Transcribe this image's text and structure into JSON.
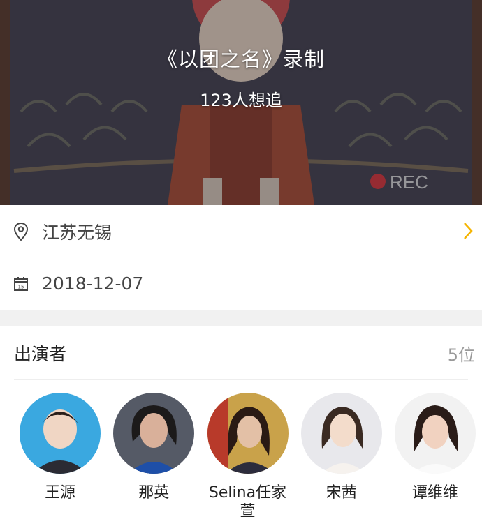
{
  "hero": {
    "title": "《以团之名》录制",
    "subtitle": "123人想追"
  },
  "info": {
    "location": "江苏无锡",
    "date": "2018-12-07"
  },
  "cast": {
    "title": "出演者",
    "count": "5位",
    "members": [
      {
        "name": "王源",
        "bg": "#3aa8e0"
      },
      {
        "name": "那英",
        "bg": "#555a66"
      },
      {
        "name": "Selina任家萱",
        "bg": "#c9a24a"
      },
      {
        "name": "宋茜",
        "bg": "#e8e8ec"
      },
      {
        "name": "谭维维",
        "bg": "#f2f2f2"
      }
    ]
  },
  "colors": {
    "accent": "#f5b400",
    "text_secondary": "#999999"
  }
}
